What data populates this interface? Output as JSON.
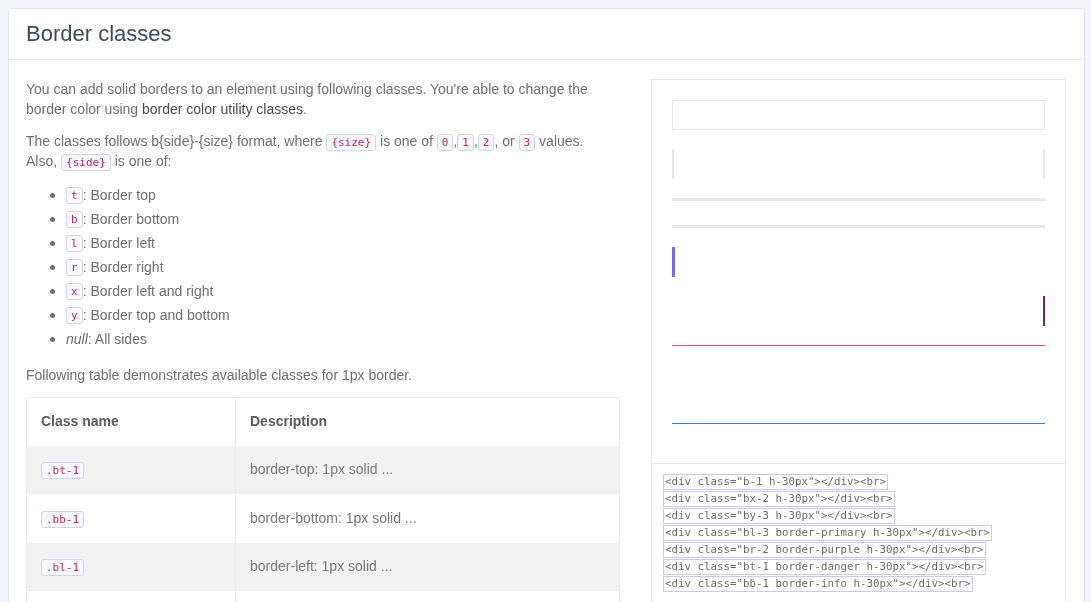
{
  "card": {
    "title": "Border classes"
  },
  "paragraphs": [
    {
      "parts": [
        {
          "kind": "text",
          "text": "You can add solid borders to an element using following classes. You're able to change the border color using "
        },
        {
          "kind": "link",
          "text": "border color utility classes"
        },
        {
          "kind": "text",
          "text": "."
        }
      ]
    },
    {
      "parts": [
        {
          "kind": "text",
          "text": "The classes follows b{side}-{size} format, where "
        },
        {
          "kind": "code",
          "text": "{size}"
        },
        {
          "kind": "text",
          "text": " is one of "
        },
        {
          "kind": "code",
          "text": "0"
        },
        {
          "kind": "text",
          "text": ","
        },
        {
          "kind": "code",
          "text": "1"
        },
        {
          "kind": "text",
          "text": ","
        },
        {
          "kind": "code",
          "text": "2"
        },
        {
          "kind": "text",
          "text": ", or "
        },
        {
          "kind": "code",
          "text": "3"
        },
        {
          "kind": "text",
          "text": " values. Also, "
        },
        {
          "kind": "code",
          "text": "{side}"
        },
        {
          "kind": "text",
          "text": " is one of:"
        }
      ]
    }
  ],
  "sides_list": [
    {
      "kind": "code",
      "code": "t",
      "text": ": Border top"
    },
    {
      "kind": "code",
      "code": "b",
      "text": ": Border bottom"
    },
    {
      "kind": "code",
      "code": "l",
      "text": ": Border left"
    },
    {
      "kind": "code",
      "code": "r",
      "text": ": Border right"
    },
    {
      "kind": "code",
      "code": "x",
      "text": ": Border left and right"
    },
    {
      "kind": "code",
      "code": "y",
      "text": ": Border top and bottom"
    },
    {
      "kind": "note",
      "text": "*null*: All sides"
    }
  ],
  "table_intro": "Following table demonstrates available classes for 1px border.",
  "table": {
    "columns": [
      "Class name",
      "Description"
    ],
    "rows": [
      {
        "class_name": ".bt-1",
        "description": "border-top: 1px solid ..."
      },
      {
        "class_name": ".bb-1",
        "description": "border-bottom: 1px solid ..."
      },
      {
        "class_name": ".bl-1",
        "description": "border-left: 1px solid ..."
      }
    ]
  },
  "demo": {
    "samples": [
      {
        "kind": "all",
        "color": "#e8e8e8"
      },
      {
        "kind": "x",
        "color": "#e8e8e8"
      },
      {
        "kind": "y",
        "color": "#e8e8e8"
      },
      {
        "kind": "left",
        "color": "#7367f0"
      },
      {
        "kind": "right",
        "color": "#7b2181"
      },
      {
        "kind": "top",
        "color": "#e0507a"
      },
      {
        "kind": "bottom",
        "color": "#3182ce"
      }
    ],
    "code_lines": [
      "<div class=\"b-1 h-30px\"></div><br>",
      "<div class=\"bx-2 h-30px\"></div><br>",
      "<div class=\"by-3 h-30px\"></div><br>",
      "<div class=\"bl-3 border-primary h-30px\"></div><br>",
      "<div class=\"br-2 border-purple h-30px\"></div><br>",
      "<div class=\"bt-1 border-danger h-30px\"></div><br>",
      "<div class=\"bb-1 border-info h-30px\"></div><br>"
    ]
  }
}
